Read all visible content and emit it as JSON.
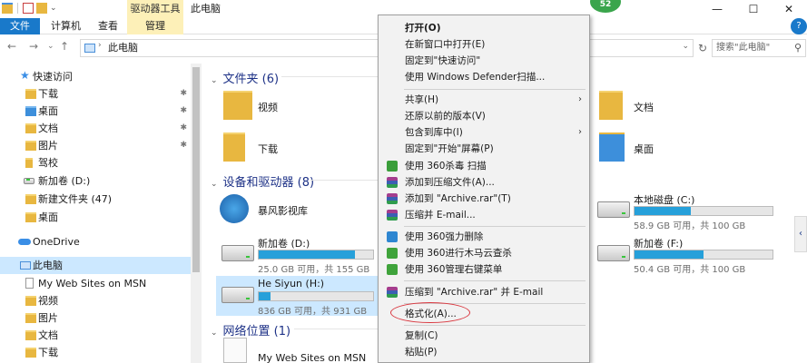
{
  "window": {
    "title": "此电脑",
    "context_tab_title": "驱动器工具",
    "badge": "52",
    "controls": {
      "minimize": "—",
      "maximize": "☐",
      "close": "✕"
    }
  },
  "ribbon": {
    "tabs": [
      "文件",
      "计算机",
      "查看",
      "管理"
    ],
    "collapse": "⌄",
    "help": "?"
  },
  "address": {
    "path": "此电脑",
    "search_placeholder": "搜索\"此电脑\"",
    "back": "←",
    "forward": "→",
    "recent": "⌄",
    "up": "↑",
    "dropdown": "⌄",
    "refresh": "↻",
    "separator": "›",
    "search_icon": "⚲"
  },
  "sidebar": {
    "pin": "✱",
    "items": [
      {
        "label": "快速访问",
        "icon": "star-icon"
      },
      {
        "label": "下载",
        "icon": "download-folder-icon",
        "pinned": true
      },
      {
        "label": "桌面",
        "icon": "desktop-folder-icon",
        "pinned": true
      },
      {
        "label": "文档",
        "icon": "documents-folder-icon",
        "pinned": true
      },
      {
        "label": "图片",
        "icon": "pictures-folder-icon",
        "pinned": true
      },
      {
        "label": "驾校",
        "icon": "folder-icon"
      },
      {
        "label": "新加卷 (D:)",
        "icon": "drive-icon"
      },
      {
        "label": "新建文件夹 (47)",
        "icon": "folder-icon"
      },
      {
        "label": "桌面",
        "icon": "folder-icon"
      },
      {
        "label": "OneDrive",
        "icon": "cloud-icon"
      },
      {
        "label": "此电脑",
        "icon": "pc-icon",
        "selected": true
      },
      {
        "label": "My Web Sites on MSN",
        "icon": "web-icon"
      },
      {
        "label": "视频",
        "icon": "videos-folder-icon"
      },
      {
        "label": "图片",
        "icon": "pictures-folder-icon"
      },
      {
        "label": "文档",
        "icon": "documents-folder-icon"
      },
      {
        "label": "下载",
        "icon": "download-folder-icon"
      }
    ]
  },
  "main": {
    "group_toggle": "⌄",
    "folders_header": "文件夹 (6)",
    "folders": [
      "视频",
      "下载",
      "文档",
      "桌面"
    ],
    "devices_header": "设备和驱动器 (8)",
    "app_item": "暴风影视库",
    "drives": [
      {
        "name": "新加卷 (D:)",
        "info": "25.0 GB 可用，共 155 GB",
        "used": 0.84
      },
      {
        "name": "He Siyun (H:)",
        "info": "836 GB 可用，共 931 GB",
        "used": 0.1,
        "selected": true
      },
      {
        "name": "本地磁盘 (C:)",
        "info": "58.9 GB 可用，共 100 GB",
        "used": 0.41
      },
      {
        "name": "新加卷 (F:)",
        "info": "50.4 GB 可用，共 100 GB",
        "used": 0.5
      }
    ],
    "network_header": "网络位置 (1)",
    "network_item": "My Web Sites on MSN",
    "expand_arrow": "‹"
  },
  "context_menu": {
    "submenu_arrow": "›",
    "items": [
      {
        "label": "打开(O)",
        "bold": true
      },
      {
        "label": "在新窗口中打开(E)"
      },
      {
        "label": "固定到\"快速访问\""
      },
      {
        "label": "使用 Windows Defender扫描..."
      },
      {
        "label": "共享(H)",
        "submenu": true
      },
      {
        "label": "还原以前的版本(V)"
      },
      {
        "label": "包含到库中(I)",
        "submenu": true
      },
      {
        "label": "固定到\"开始\"屏幕(P)"
      },
      {
        "label": "使用 360杀毒 扫描",
        "icon": "shield-icon"
      },
      {
        "label": "添加到压缩文件(A)...",
        "icon": "rar-icon"
      },
      {
        "label": "添加到 \"Archive.rar\"(T)",
        "icon": "rar-icon"
      },
      {
        "label": "压缩并 E-mail...",
        "icon": "rar-icon"
      },
      {
        "label": "使用 360强力删除",
        "icon": "360-delete-icon"
      },
      {
        "label": "使用 360进行木马云查杀",
        "icon": "360-icon"
      },
      {
        "label": "使用 360管理右键菜单",
        "icon": "360-icon"
      },
      {
        "label": "压缩到 \"Archive.rar\" 并 E-mail",
        "icon": "rar-icon"
      },
      {
        "label": "格式化(A)..."
      },
      {
        "label": "复制(C)"
      },
      {
        "label": "粘贴(P)"
      }
    ]
  }
}
